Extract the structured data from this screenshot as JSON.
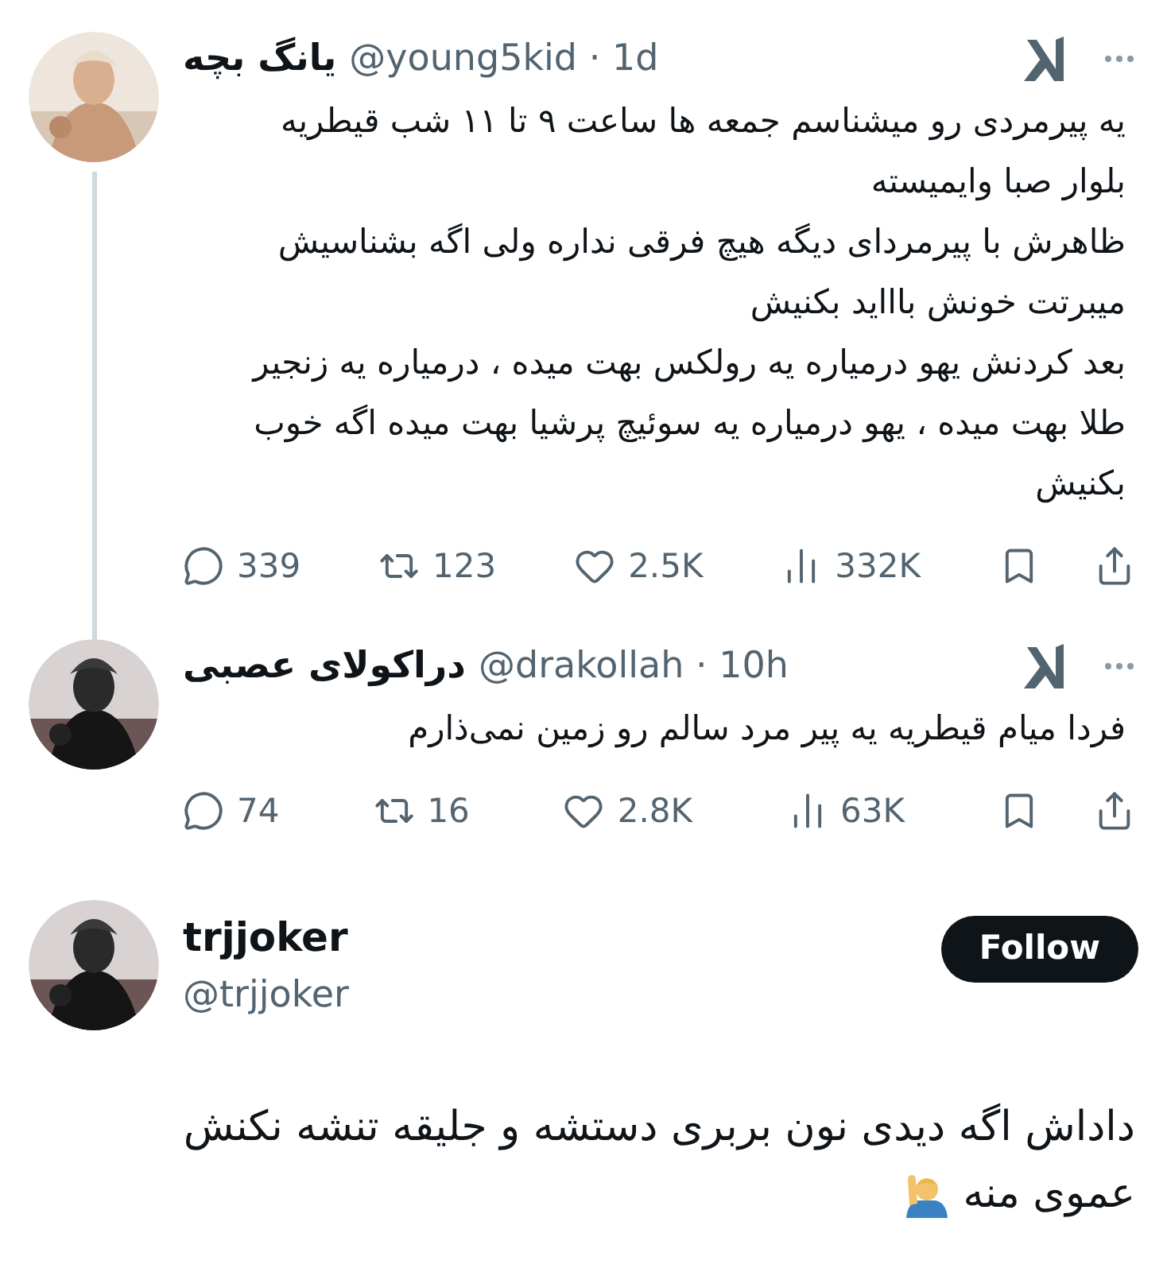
{
  "posts": [
    {
      "kind": "reply",
      "name": "یانگ بچه",
      "handle": "@young5kid",
      "time": "1d",
      "sep": "·",
      "thread": true,
      "paragraphs": [
        "یه پیرمردی رو میشناسم جمعه ها ساعت ۹ تا ۱۱ شب قیطریه بلوار صبا وایمیسته",
        "ظاهرش با پیرمردای دیگه هیچ فرقی نداره ولی اگه بشناسیش میبرتت خونش باااید بکنیش",
        "بعد کردنش یهو درمیاره یه رولکس بهت میده ، درمیاره یه زنجیر طلا بهت میده ، یهو درمیاره یه سوئیچ پرشیا بهت میده اگه خوب بکنیش"
      ],
      "stats": {
        "replies": "339",
        "reposts": "123",
        "likes": "2.5K",
        "views": "332K"
      }
    },
    {
      "kind": "reply",
      "name": "دراکولای عصبی",
      "handle": "@drakollah",
      "time": "10h",
      "sep": "·",
      "thread": false,
      "paragraphs": [
        "فردا میام قیطریه یه پیر مرد سالم رو زمین نمی‌ذارم"
      ],
      "stats": {
        "replies": "74",
        "reposts": "16",
        "likes": "2.8K",
        "views": "63K"
      }
    },
    {
      "kind": "main",
      "name": "trjjoker",
      "handle": "@trjjoker",
      "follow": "Follow",
      "lines": [
        "داداش اگه دیدی نون بربری دستشه و جلیقه تنشه نکنش",
        "عموی منه"
      ]
    }
  ]
}
